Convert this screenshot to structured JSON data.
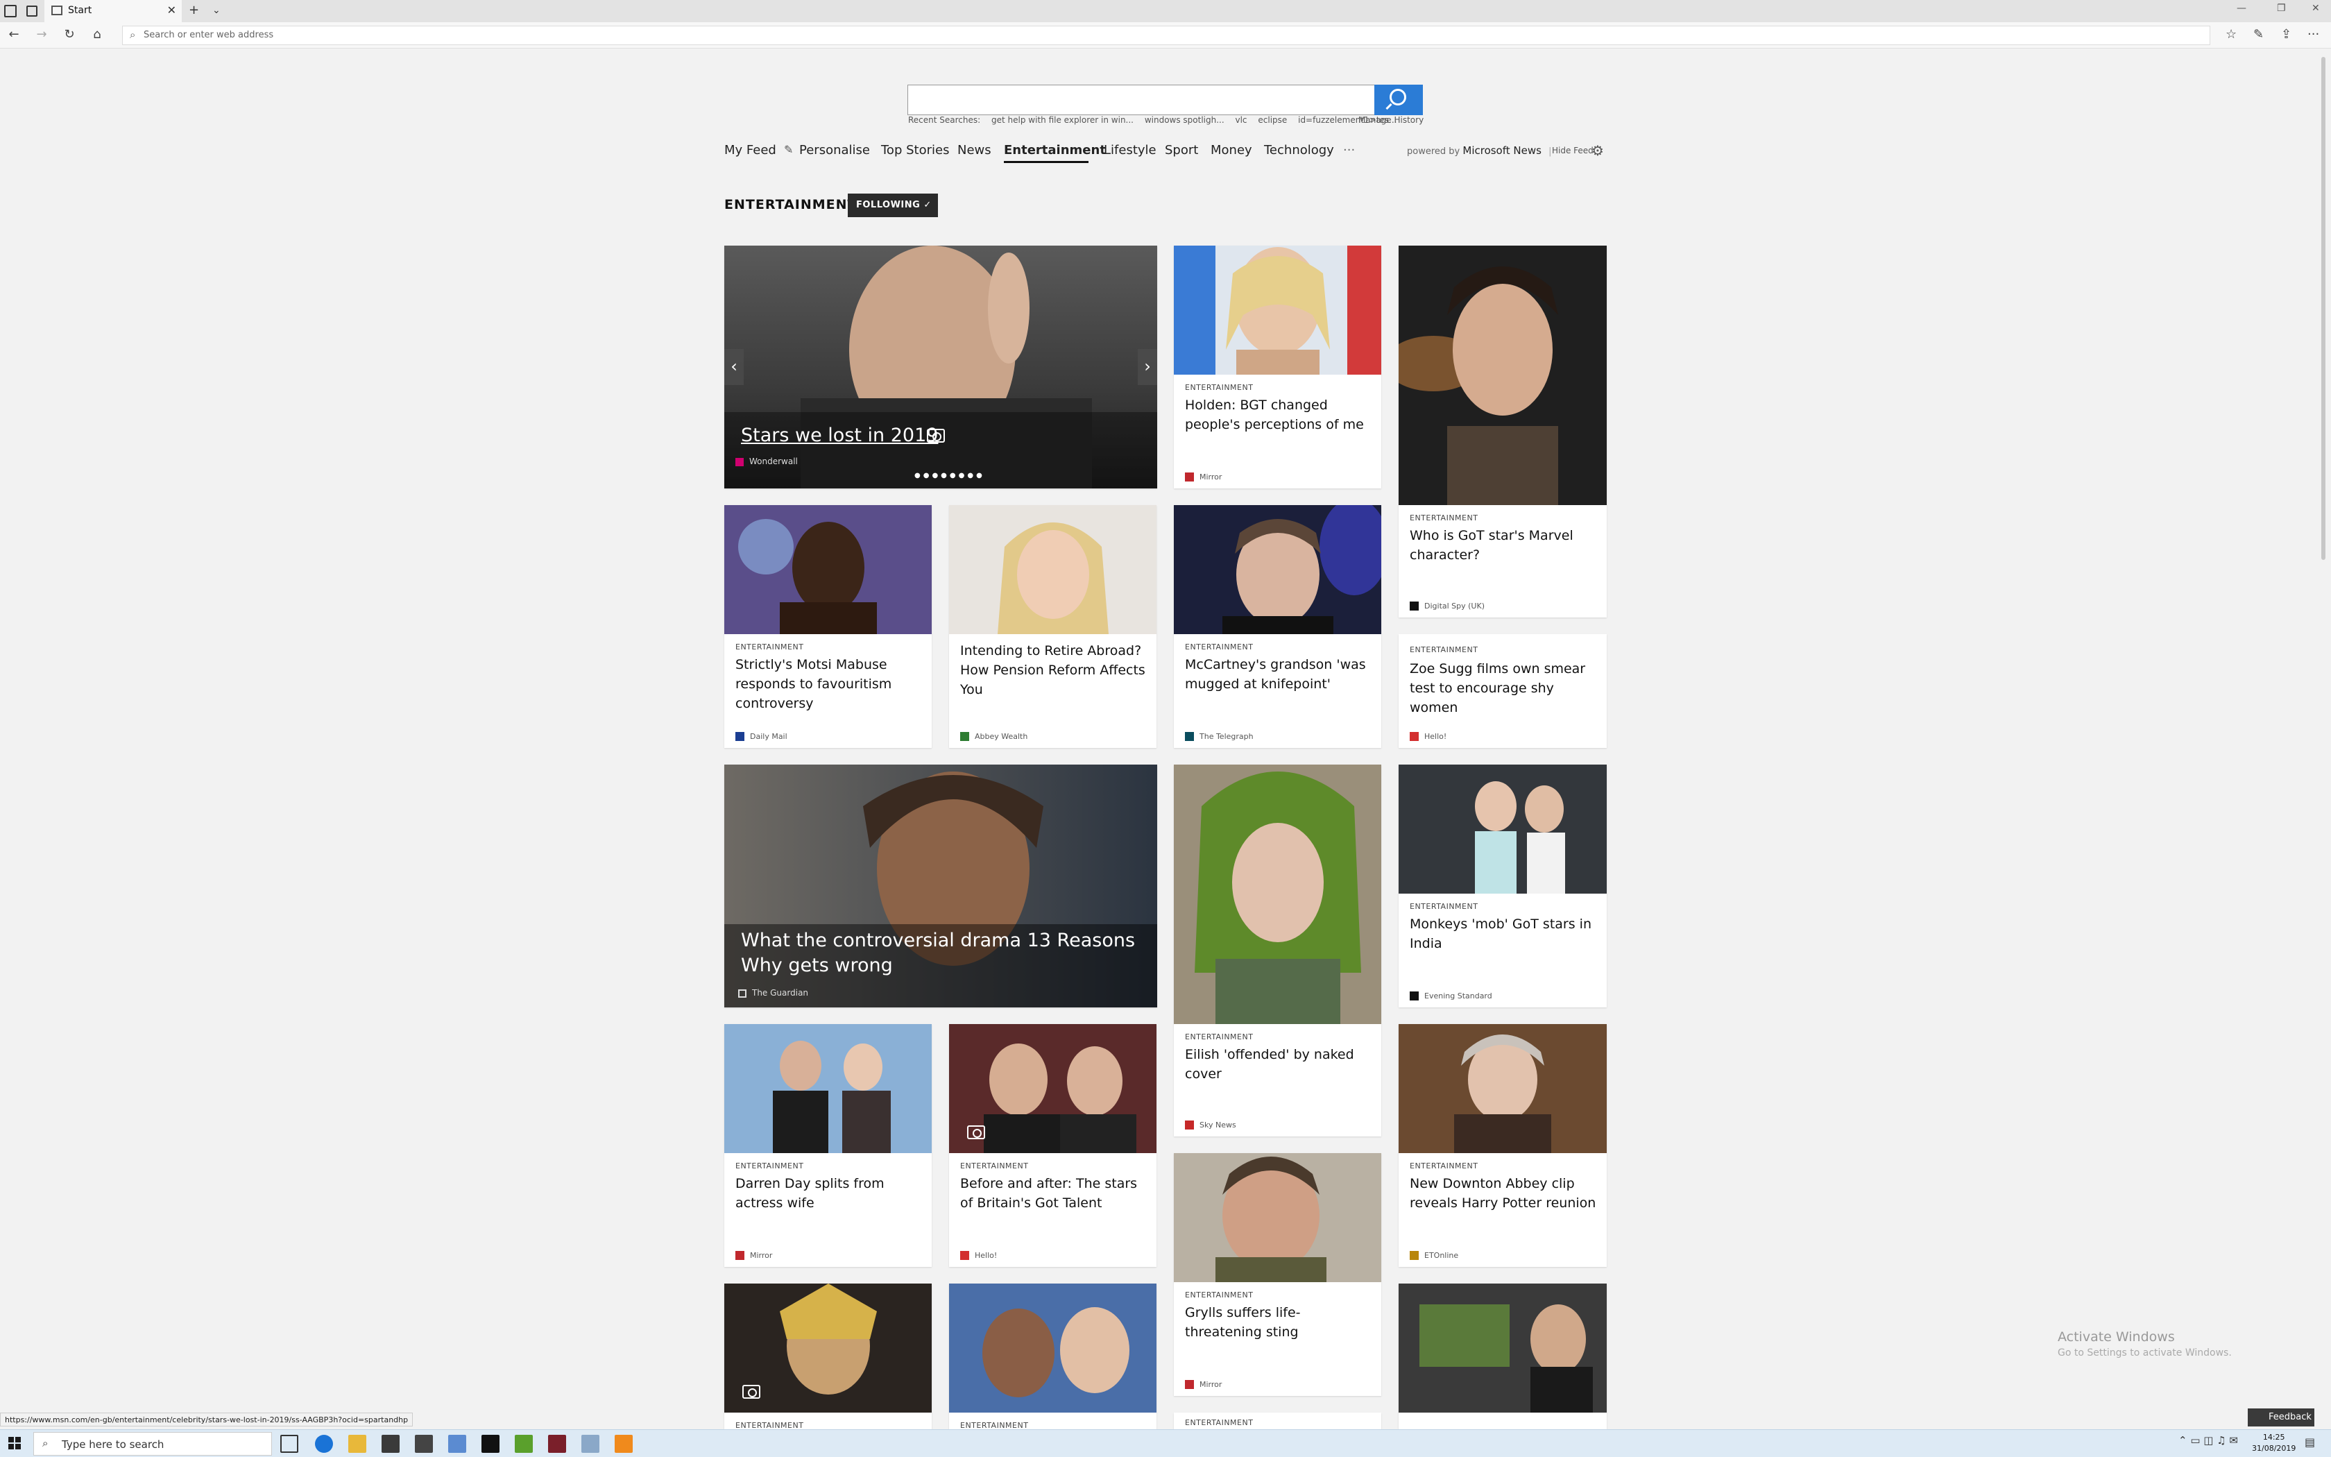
{
  "browser": {
    "tab_title": "Start",
    "address_placeholder": "Search or enter web address",
    "status_url": "https://www.msn.com/en-gb/entertainment/celebrity/stars-we-lost-in-2019/ss-AAGBP3h?ocid=spartandhp"
  },
  "search": {
    "recent_label": "Recent Searches:",
    "recent_items": [
      "get help with file explorer in win...",
      "windows spotligh...",
      "vlc",
      "eclipse",
      "id=fuzzelement1>tes..."
    ],
    "manage_history": "Manage History"
  },
  "feed_nav": {
    "items": [
      "My Feed",
      "Personalise",
      "Top Stories",
      "News",
      "Entertainment",
      "Lifestyle",
      "Sport",
      "Money",
      "Technology",
      "···"
    ],
    "active": "Entertainment",
    "powered_by": "powered by",
    "brand": "Microsoft News",
    "hide_feed": "Hide Feed"
  },
  "section": {
    "title": "ENTERTAINMENT",
    "following": "FOLLOWING ✓"
  },
  "cards": {
    "hero": {
      "title": "Stars we lost in 2019",
      "source": "Wonderwall"
    },
    "c1": {
      "category": "ENTERTAINMENT",
      "title": "Holden: BGT changed people's perceptions of me",
      "source": "Mirror"
    },
    "c2": {
      "category": "ENTERTAINMENT",
      "title": "Who is GoT star's Marvel character?",
      "source": "Digital Spy (UK)"
    },
    "c3": {
      "category": "ENTERTAINMENT",
      "title": "Strictly's Motsi Mabuse responds to favouritism controversy",
      "source": "Daily Mail"
    },
    "c4": {
      "title": "Intending to Retire Abroad? How Pension Reform Affects You",
      "source": "Abbey Wealth"
    },
    "c5": {
      "category": "ENTERTAINMENT",
      "title": "McCartney's grandson 'was mugged at knifepoint'",
      "source": "The Telegraph"
    },
    "c6": {
      "category": "ENTERTAINMENT",
      "title": "Zoe Sugg films own smear test to encourage shy women",
      "source": "Hello!"
    },
    "c7": {
      "title": "What the controversial drama 13 Reasons Why gets wrong",
      "source": "The Guardian"
    },
    "c8": {
      "category": "ENTERTAINMENT",
      "title": "Eilish 'offended' by naked cover",
      "source": "Sky News"
    },
    "c9": {
      "category": "ENTERTAINMENT",
      "title": "Monkeys 'mob' GoT stars in India",
      "source": "Evening Standard"
    },
    "c10": {
      "category": "ENTERTAINMENT",
      "title": "Darren Day splits from actress wife",
      "source": "Mirror"
    },
    "c11": {
      "category": "ENTERTAINMENT",
      "title": "Before and after: The stars of Britain's Got Talent",
      "source": "Hello!"
    },
    "c12": {
      "category": "ENTERTAINMENT",
      "title": "New Downton Abbey clip reveals Harry Potter reunion",
      "source": "ETOnline"
    },
    "c13": {
      "category": "ENTERTAINMENT",
      "title": "Grylls suffers life-threatening sting",
      "source": "Mirror"
    },
    "c14": {
      "category": "ENTERTAINMENT"
    },
    "c15": {
      "category": "ENTERTAINMENT"
    },
    "c16": {
      "category": "ENTERTAINMENT"
    }
  },
  "watermark": {
    "line1": "Activate Windows",
    "line2": "Go to Settings to activate Windows."
  },
  "feedback": "Feedback",
  "taskbar": {
    "search_placeholder": "Type here to search",
    "time": "14:25",
    "date": "31/08/2019"
  }
}
